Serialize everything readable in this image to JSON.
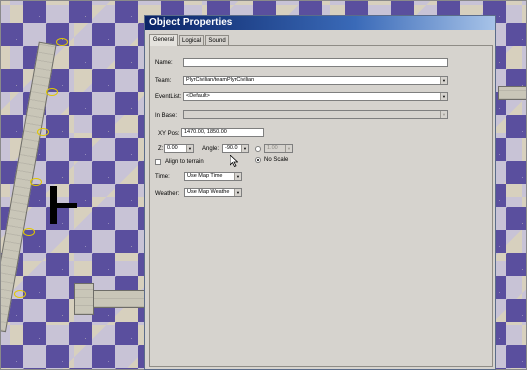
{
  "dialog": {
    "title": "Object Properties"
  },
  "tabs": [
    {
      "label": "General"
    },
    {
      "label": "Logical"
    },
    {
      "label": "Sound"
    }
  ],
  "form": {
    "name": {
      "label": "Name:",
      "value": ""
    },
    "team": {
      "label": "Team:",
      "value": "PlyrCivilian/teamPlyrCivilian"
    },
    "eventlist": {
      "label": "EventList:",
      "value": "<Default>"
    },
    "in_base": {
      "label": "In Base:",
      "value": ""
    },
    "xy_pos": {
      "label": "XY Pos:",
      "value": "1470.00, 1850.00"
    },
    "z": {
      "label": "Z:",
      "value": "0.00"
    },
    "angle": {
      "label": "Angle:",
      "value": "-90.0"
    },
    "scale": {
      "value": "1.00",
      "selected": false
    },
    "no_scale": {
      "label": "No Scale",
      "selected": true
    },
    "align": {
      "label": "Align to terrain",
      "checked": false
    },
    "time": {
      "label": "Time:",
      "value": "Use Map Time"
    },
    "weather": {
      "label": "Weather:",
      "value": "Use Map Weathe"
    }
  },
  "colors": {
    "title_bar": "#0b2466",
    "dialog_bg": "#d6d3ce"
  }
}
